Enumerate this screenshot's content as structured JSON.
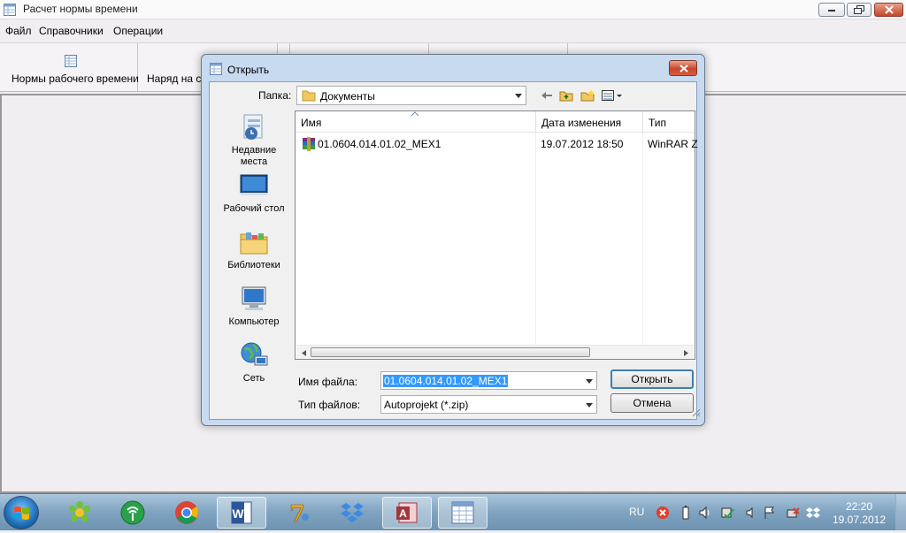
{
  "app": {
    "title": "Расчет нормы времени",
    "title_icon": "table-icon"
  },
  "menu": [
    "Файл",
    "Справочники",
    "Операции"
  ],
  "toolbar": {
    "buttons": [
      {
        "label": "Нормы рабочего времени",
        "icon": "table-icon"
      },
      {
        "label": "Наряд на сд"
      },
      {
        "label": ""
      },
      {
        "label": ""
      },
      {
        "label": ""
      }
    ]
  },
  "dialog": {
    "title": "Открыть",
    "folder_label": "Папка:",
    "folder_value": "Документы",
    "places": [
      "Недавние места",
      "Рабочий стол",
      "Библиотеки",
      "Компьютер",
      "Сеть"
    ],
    "columns": [
      "Имя",
      "Дата изменения",
      "Тип"
    ],
    "files": [
      {
        "name": "01.0604.014.01.02_MEX1",
        "date": "19.07.2012 18:50",
        "type": "WinRAR Z",
        "icon": "winrar-archive-icon"
      }
    ],
    "filename_label": "Имя файла:",
    "filename_value": "01.0604.014.01.02_MEX1",
    "filetype_label": "Тип файлов:",
    "filetype_value": "Autoprojekt (*.zip)",
    "open_button": "Открыть",
    "cancel_button": "Отмена"
  },
  "taskbar": {
    "apps": [
      "icq-icon",
      "radio-icon",
      "chrome-icon",
      "word-icon",
      "seven-icon",
      "dropbox-icon",
      "access-icon",
      "table-app-icon"
    ],
    "language": "RU",
    "clock_time": "22:20",
    "clock_date": "19.07.2012"
  }
}
